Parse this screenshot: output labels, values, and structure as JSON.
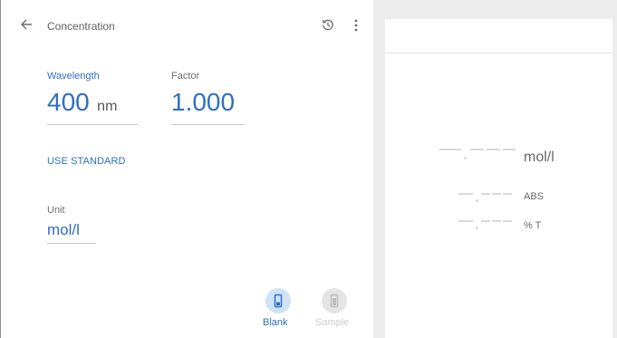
{
  "header": {
    "title": "Concentration"
  },
  "wavelength": {
    "label": "Wavelength",
    "value": "400",
    "unit": "nm"
  },
  "factor": {
    "label": "Factor",
    "value": "1.000"
  },
  "use_standard": "USE STANDARD",
  "unit": {
    "label": "Unit",
    "value": "mol/l"
  },
  "actions": {
    "blank_label": "Blank",
    "sample_label": "Sample"
  },
  "readout": {
    "concentration_unit": "mol/l",
    "abs_unit": "ABS",
    "transmittance_unit": "% T"
  },
  "colors": {
    "accent": "#2f6fc1",
    "accent_light": "#cfe2f6",
    "disabled": "#cfcfcf"
  },
  "icons": [
    "back-arrow-icon",
    "history-icon",
    "more-vert-icon",
    "cuvette-icon"
  ]
}
